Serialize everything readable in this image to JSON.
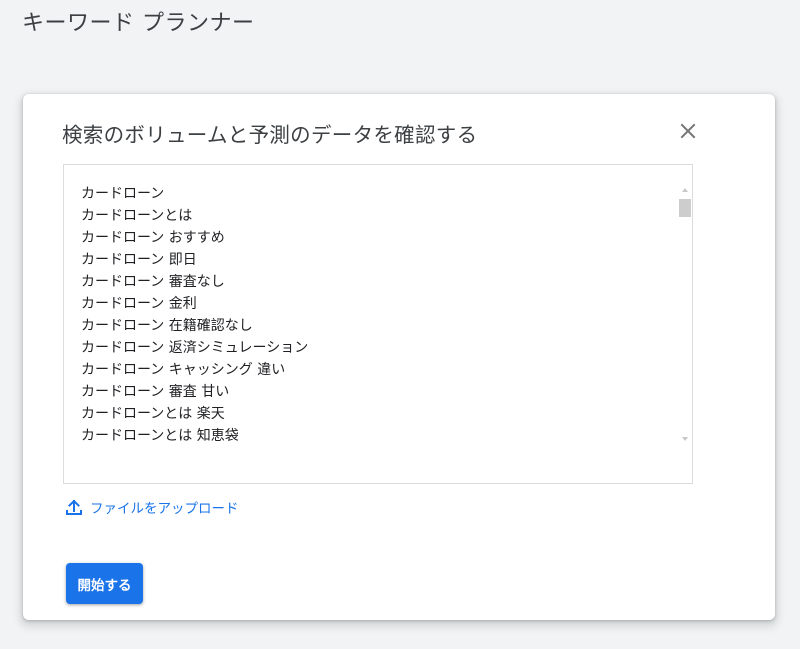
{
  "page": {
    "title": "キーワード プランナー"
  },
  "dialog": {
    "title": "検索のボリュームと予測のデータを確認する",
    "close_icon": "close-icon",
    "keywords": [
      "カードローン",
      "カードローンとは",
      "カードローン おすすめ",
      "カードローン 即日",
      "カードローン 審査なし",
      "カードローン 金利",
      "カードローン 在籍確認なし",
      "カードローン 返済シミュレーション",
      "カードローン キャッシング 違い",
      "カードローン 審査 甘い",
      "カードローンとは 楽天",
      "カードローンとは 知恵袋"
    ],
    "upload": {
      "icon": "upload-icon",
      "label": "ファイルをアップロード"
    },
    "start_button": {
      "label": "開始する"
    }
  },
  "colors": {
    "accent": "#1a73e8",
    "background": "#f1f3f4",
    "dialog": "#ffffff",
    "text": "#202124",
    "muted_icon": "#757575"
  }
}
